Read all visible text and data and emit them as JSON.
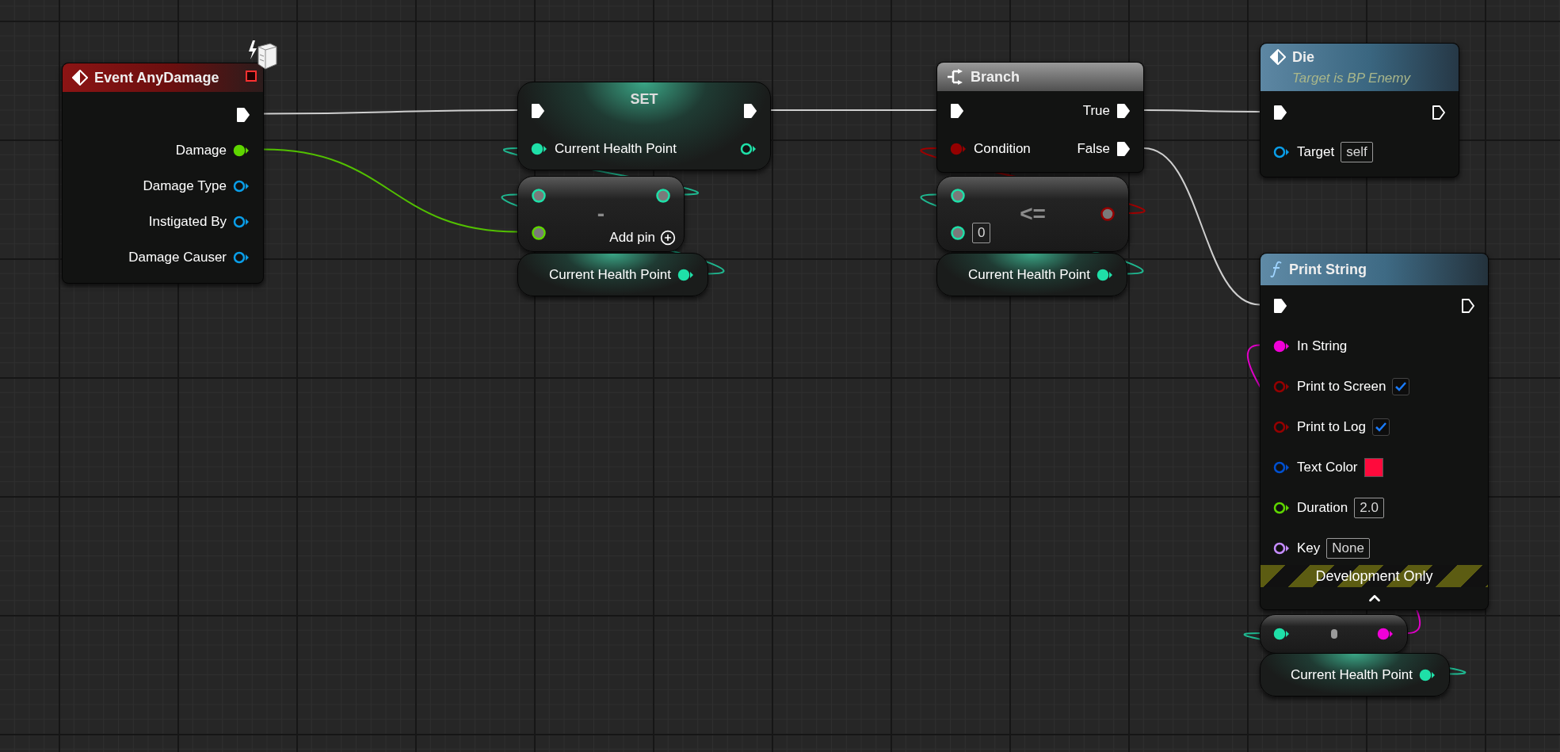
{
  "nodes": [
    {
      "kind": "event",
      "title": "Event AnyDamage",
      "outputs": [
        {
          "kind": "exec",
          "connected": true
        },
        {
          "label": "Damage",
          "kind": "float",
          "connected": true
        },
        {
          "label": "Damage Type",
          "kind": "object",
          "connected": false
        },
        {
          "label": "Instigated By",
          "kind": "object",
          "connected": false
        },
        {
          "label": "Damage Causer",
          "kind": "object",
          "connected": false
        }
      ]
    },
    {
      "kind": "set",
      "title": "SET",
      "inputs": [
        {
          "kind": "exec",
          "connected": true
        },
        {
          "label": "Current Health Point",
          "kind": "int",
          "connected": true
        }
      ],
      "outputs": [
        {
          "kind": "exec",
          "connected": true
        },
        {
          "kind": "int",
          "connected": false
        }
      ]
    },
    {
      "kind": "operator",
      "symbol": "-",
      "inputs": [
        {
          "kind": "int"
        },
        {
          "kind": "float"
        }
      ],
      "outputs": [
        {
          "kind": "int"
        },
        {
          "kind": "add_pin",
          "label": "Add pin"
        }
      ]
    },
    {
      "kind": "getter",
      "outputs": [
        {
          "label": "Current Health Point",
          "kind": "int",
          "connected": true
        }
      ]
    },
    {
      "kind": "branch",
      "title": "Branch",
      "inputs": [
        {
          "kind": "exec",
          "connected": true
        },
        {
          "label": "Condition",
          "kind": "bool",
          "connected": true
        }
      ],
      "outputs": [
        {
          "label": "True",
          "kind": "exec",
          "connected": true
        },
        {
          "label": "False",
          "kind": "exec",
          "connected": true
        }
      ]
    },
    {
      "kind": "operator",
      "symbol": "<=",
      "inputs": [
        {
          "kind": "int"
        },
        {
          "kind": "int",
          "value": "0"
        }
      ],
      "outputs": [
        {
          "kind": "bool"
        }
      ]
    },
    {
      "kind": "getter",
      "outputs": [
        {
          "label": "Current Health Point",
          "kind": "int",
          "connected": true
        }
      ]
    },
    {
      "kind": "custom_event_call",
      "title": "Die",
      "subtitle": "Target is BP Enemy",
      "inputs": [
        {
          "kind": "exec",
          "connected": true
        },
        {
          "label": "Target",
          "kind": "object",
          "connected": false,
          "value": "self"
        }
      ],
      "outputs": [
        {
          "kind": "exec",
          "connected": false
        }
      ]
    },
    {
      "kind": "function",
      "title": "Print String",
      "inputs": [
        {
          "kind": "exec",
          "connected": true
        },
        {
          "label": "In String",
          "kind": "string",
          "connected": true
        },
        {
          "label": "Print to Screen",
          "kind": "bool",
          "connected": false,
          "checked": true
        },
        {
          "label": "Print to Log",
          "kind": "bool",
          "connected": false,
          "checked": true
        },
        {
          "label": "Text Color",
          "kind": "struct",
          "connected": false,
          "color": "#ff0a3c"
        },
        {
          "label": "Duration",
          "kind": "float",
          "connected": false,
          "value": "2.0"
        },
        {
          "label": "Key",
          "kind": "name",
          "connected": false,
          "value": "None"
        }
      ],
      "outputs": [
        {
          "kind": "exec",
          "connected": false
        }
      ],
      "banner": "Development Only",
      "advanced_expanded": true
    },
    {
      "kind": "conversion",
      "inputs": [
        {
          "kind": "int",
          "connected": true
        }
      ],
      "outputs": [
        {
          "kind": "string",
          "connected": true
        }
      ]
    },
    {
      "kind": "getter",
      "outputs": [
        {
          "label": "Current Health Point",
          "kind": "int",
          "connected": true
        }
      ]
    }
  ]
}
